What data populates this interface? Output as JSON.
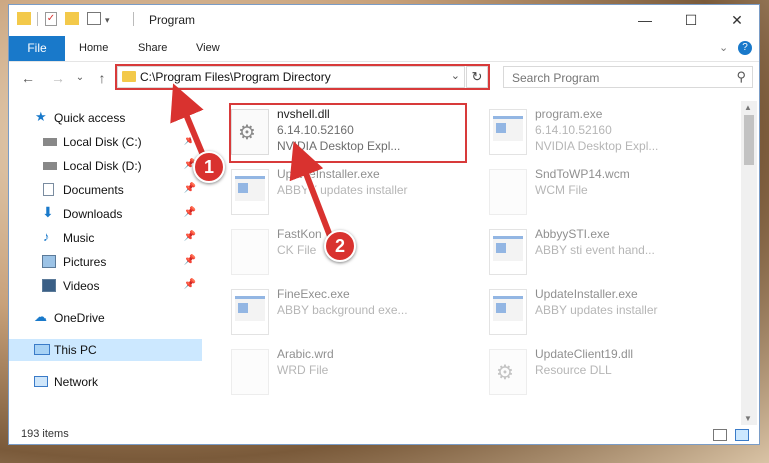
{
  "window": {
    "title": "Program"
  },
  "titlebar_buttons": {
    "minimize": "—",
    "maximize": "☐",
    "close": "✕"
  },
  "ribbon": {
    "tabs": [
      "File",
      "Home",
      "Share",
      "View"
    ],
    "expand": "⌄",
    "help": "?"
  },
  "nav": {
    "back": "←",
    "forward": "→",
    "recent": "⌄",
    "up": "↑"
  },
  "address": {
    "path": "C:\\Program Files\\Program Directory",
    "dropdown": "⌄",
    "refresh": "↻"
  },
  "search": {
    "placeholder": "Search Program",
    "icon": "search-icon"
  },
  "sidebar": {
    "items": [
      {
        "label": "Quick access",
        "icon": "star-icon",
        "pinned": false
      },
      {
        "label": "Local Disk (C:)",
        "icon": "drive-icon",
        "pinned": true
      },
      {
        "label": "Local Disk (D:)",
        "icon": "drive-icon",
        "pinned": true
      },
      {
        "label": "Documents",
        "icon": "documents-icon",
        "pinned": true
      },
      {
        "label": "Downloads",
        "icon": "download-icon",
        "pinned": true
      },
      {
        "label": "Music",
        "icon": "music-icon",
        "pinned": true
      },
      {
        "label": "Pictures",
        "icon": "pictures-icon",
        "pinned": true
      },
      {
        "label": "Videos",
        "icon": "videos-icon",
        "pinned": true
      },
      {
        "label": "OneDrive",
        "icon": "cloud-icon",
        "pinned": false
      },
      {
        "label": "This PC",
        "icon": "computer-icon",
        "pinned": false,
        "selected": true
      },
      {
        "label": "Network",
        "icon": "network-icon",
        "pinned": false
      }
    ]
  },
  "files": [
    {
      "name": "nvshell.dll",
      "line1": "6.14.10.52160",
      "line2": "NVIDIA Desktop Expl...",
      "kind": "dll",
      "highlighted": true
    },
    {
      "name": "program.exe",
      "line1": "6.14.10.52160",
      "line2": "NVIDIA Desktop Expl...",
      "kind": "exe"
    },
    {
      "name": "UpdateInstaller.exe",
      "line1": "ABBYY updates installer",
      "line2": "",
      "kind": "exe"
    },
    {
      "name": "SndToWP14.wcm",
      "line1": "WCM File",
      "line2": "",
      "kind": "blank"
    },
    {
      "name": "FastKon",
      "line1": "CK File",
      "line2": "",
      "kind": "blank"
    },
    {
      "name": "AbbyySTI.exe",
      "line1": "ABBY sti event hand...",
      "line2": "",
      "kind": "exe"
    },
    {
      "name": "FineExec.exe",
      "line1": "ABBY background exe...",
      "line2": "",
      "kind": "exe"
    },
    {
      "name": "UpdateInstaller.exe",
      "line1": "ABBY updates installer",
      "line2": "",
      "kind": "exe"
    },
    {
      "name": "Arabic.wrd",
      "line1": "WRD File",
      "line2": "",
      "kind": "blank"
    },
    {
      "name": "UpdateClient19.dll",
      "line1": "Resource DLL",
      "line2": "",
      "kind": "dll"
    }
  ],
  "status": {
    "count": "193 items"
  },
  "callouts": [
    "1",
    "2"
  ],
  "colors": {
    "accent": "#1979ca",
    "highlight": "#d83a3a",
    "selected": "#cce8ff"
  }
}
